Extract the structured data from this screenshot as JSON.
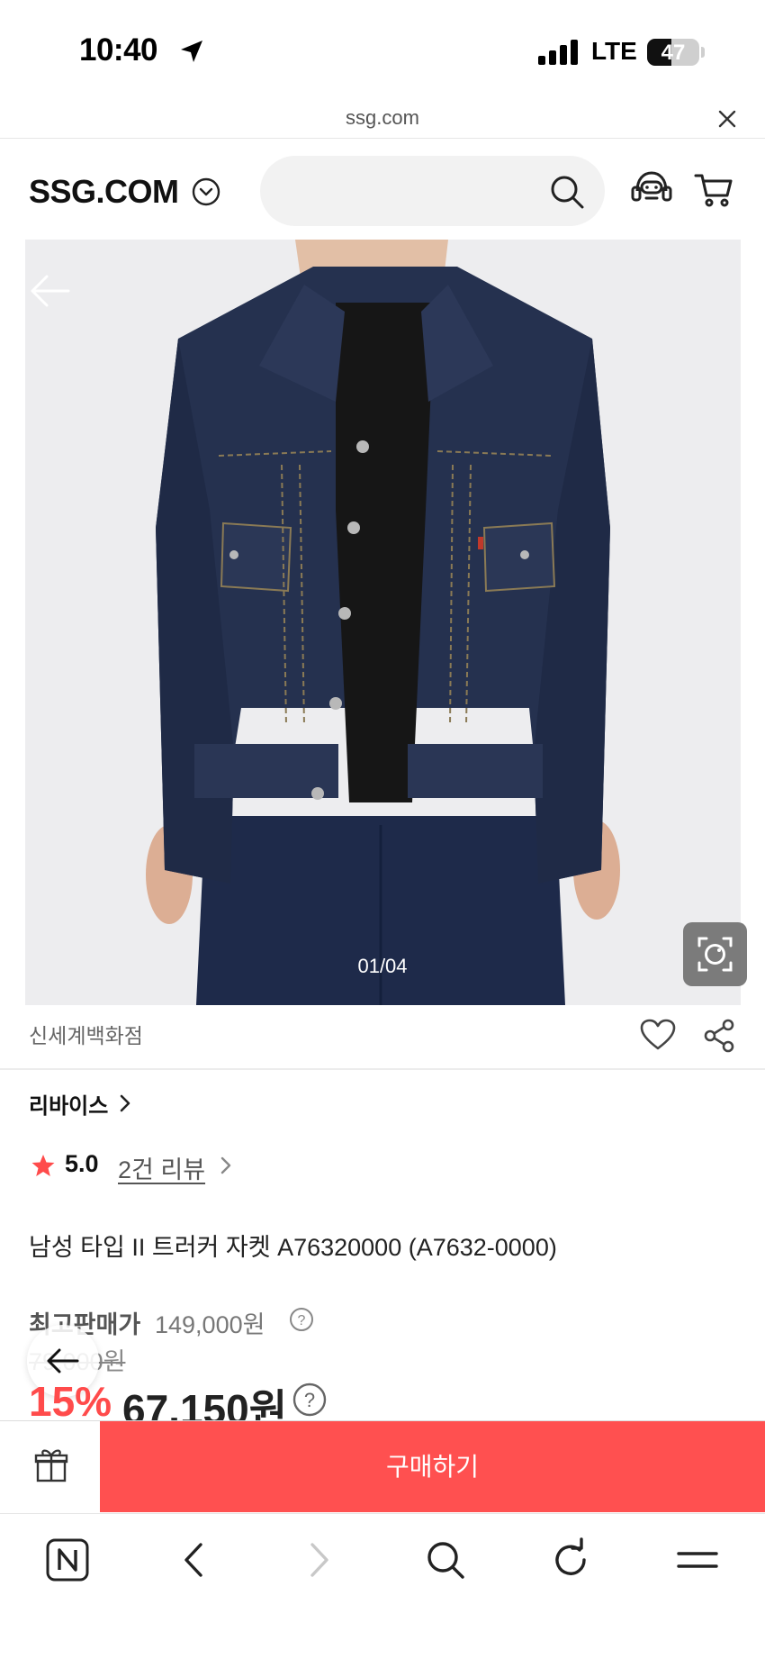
{
  "status_bar": {
    "time": "10:40",
    "network": "LTE",
    "battery_percent": "47",
    "battery_level": 0.47,
    "icons": [
      "location-arrow-icon",
      "signal-bars-icon",
      "battery-icon"
    ]
  },
  "browser": {
    "url": "ssg.com",
    "close_icon": "close-icon"
  },
  "header": {
    "logo": "SSG.COM",
    "icons": [
      "chevron-down-circle-icon",
      "search-icon",
      "customer-service-icon",
      "cart-icon"
    ]
  },
  "product_image": {
    "counter": "01/04",
    "icons": [
      "back-arrow-icon",
      "lens-search-icon"
    ]
  },
  "store": {
    "name": "신세계백화점",
    "icons": [
      "heart-icon",
      "share-icon"
    ]
  },
  "product": {
    "brand": "리바이스",
    "rating": "5.0",
    "review_link": "2건 리뷰",
    "title": "남성 타입 II 트러커 자켓 A76320000 (A7632-0000)",
    "max_price_label": "최고판매가",
    "max_price": "149,000원",
    "original_price": "79,000원",
    "discount": "15%",
    "sale_price": "67,150원"
  },
  "action_bar": {
    "buy_label": "구매하기",
    "gift_icon": "gift-icon"
  },
  "toolbar": {
    "icons": [
      "naver-n-icon",
      "back-icon",
      "forward-icon",
      "search-icon",
      "reload-icon",
      "menu-icon"
    ]
  },
  "colors": {
    "accent": "#ff5050",
    "discount": "#ff4b4b",
    "star": "#ff4b4b",
    "text_dark": "#222222"
  }
}
